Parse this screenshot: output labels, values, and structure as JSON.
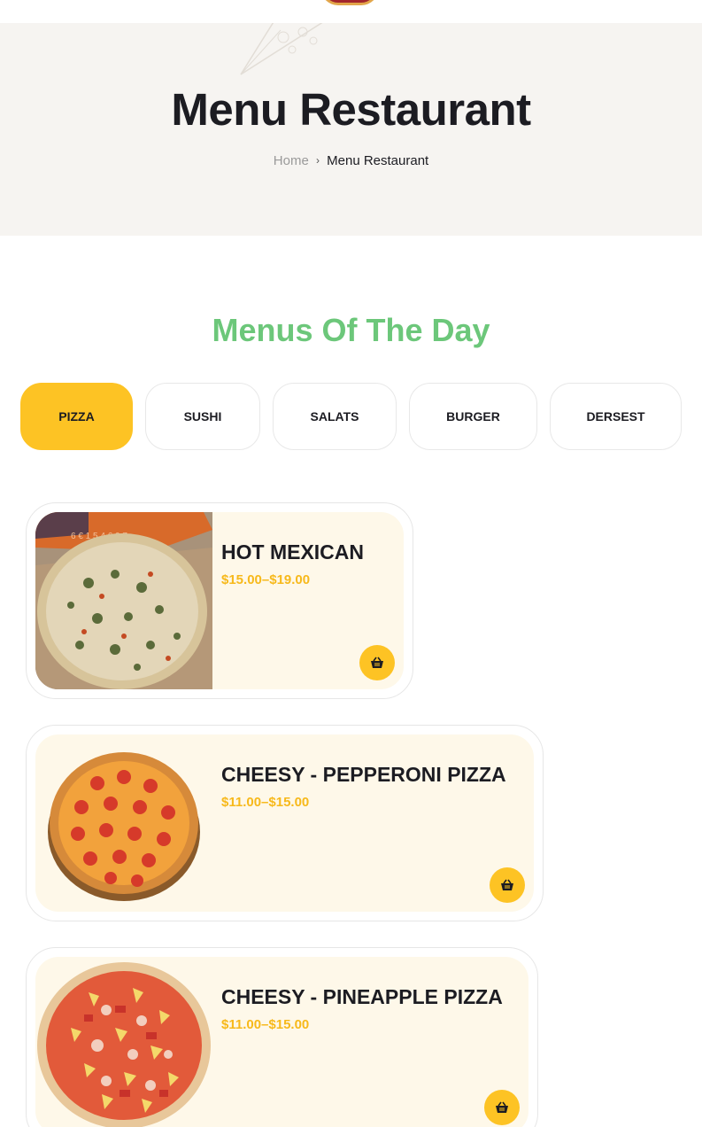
{
  "hero": {
    "title": "Menu Restaurant",
    "breadcrumb": {
      "home": "Home",
      "separator": "›",
      "current": "Menu Restaurant"
    }
  },
  "section": {
    "title": "Menus Of The Day"
  },
  "tabs": [
    {
      "label": "PIZZA",
      "active": true
    },
    {
      "label": "SUSHI",
      "active": false
    },
    {
      "label": "SALATS",
      "active": false
    },
    {
      "label": "BURGER",
      "active": false
    },
    {
      "label": "DERSEST",
      "active": false
    }
  ],
  "products": [
    {
      "name": "HOT MEXICAN",
      "price": "$15.00–$19.00",
      "image": "pizza-jalapeno-photo"
    },
    {
      "name": "CHEESY - PEPPERONI PIZZA",
      "price": "$11.00–$15.00",
      "image": "pizza-pepperoni-photo"
    },
    {
      "name": "CHEESY - PINEAPPLE PIZZA",
      "price": "$11.00–$15.00",
      "image": "pizza-pineapple-photo"
    }
  ],
  "icons": {
    "cart": "basket-icon",
    "breadcrumb_sep": "chevron-right-icon",
    "hero_decor": "pizza-slice-outline-icon"
  },
  "colors": {
    "accent": "#fdc324",
    "price": "#f7b91b",
    "section_title": "#6cc77a",
    "hero_bg": "#f6f4f1",
    "card_bg": "#fef8e9"
  }
}
